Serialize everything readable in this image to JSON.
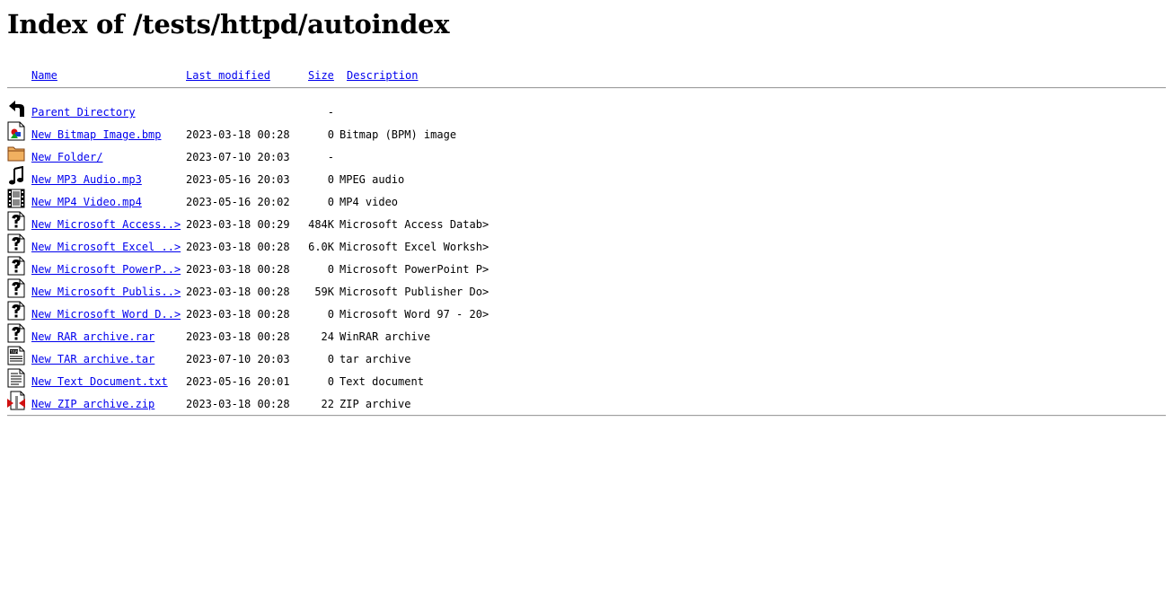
{
  "page": {
    "title": "Index of /tests/httpd/autoindex"
  },
  "columns": {
    "name": "Name",
    "last_modified": "Last modified",
    "size": "Size",
    "description": "Description"
  },
  "entries": [
    {
      "icon": "back-icon",
      "name": "Parent Directory",
      "modified": "",
      "size": "-",
      "description": ""
    },
    {
      "icon": "image-icon",
      "name": "New Bitmap Image.bmp",
      "modified": "2023-03-18 00:28",
      "size": "0",
      "description": "Bitmap (BPM) image"
    },
    {
      "icon": "folder-icon",
      "name": "New Folder/",
      "modified": "2023-07-10 20:03",
      "size": "-",
      "description": ""
    },
    {
      "icon": "audio-icon",
      "name": "New MP3 Audio.mp3",
      "modified": "2023-05-16 20:03",
      "size": "0",
      "description": "MPEG audio"
    },
    {
      "icon": "video-icon",
      "name": "New MP4 Video.mp4",
      "modified": "2023-05-16 20:02",
      "size": "0",
      "description": "MP4 video"
    },
    {
      "icon": "unknown-file-icon",
      "name": "New Microsoft Access..>",
      "modified": "2023-03-18 00:29",
      "size": "484K",
      "description": "Microsoft Access Datab>"
    },
    {
      "icon": "unknown-file-icon",
      "name": "New Microsoft Excel ..>",
      "modified": "2023-03-18 00:28",
      "size": "6.0K",
      "description": "Microsoft Excel Worksh>"
    },
    {
      "icon": "unknown-file-icon",
      "name": "New Microsoft PowerP..>",
      "modified": "2023-03-18 00:28",
      "size": "0",
      "description": "Microsoft PowerPoint P>"
    },
    {
      "icon": "unknown-file-icon",
      "name": "New Microsoft Publis..>",
      "modified": "2023-03-18 00:28",
      "size": "59K",
      "description": "Microsoft Publisher Do>"
    },
    {
      "icon": "unknown-file-icon",
      "name": "New Microsoft Word D..>",
      "modified": "2023-03-18 00:28",
      "size": "0",
      "description": "Microsoft Word 97 - 20>"
    },
    {
      "icon": "unknown-file-icon",
      "name": "New RAR archive.rar",
      "modified": "2023-03-18 00:28",
      "size": "24",
      "description": "WinRAR archive"
    },
    {
      "icon": "tar-icon",
      "name": "New TAR archive.tar",
      "modified": "2023-07-10 20:03",
      "size": "0",
      "description": "tar archive"
    },
    {
      "icon": "text-file-icon",
      "name": "New Text Document.txt",
      "modified": "2023-05-16 20:01",
      "size": "0",
      "description": "Text document"
    },
    {
      "icon": "compressed-file-icon",
      "name": "New ZIP archive.zip",
      "modified": "2023-03-18 00:28",
      "size": "22",
      "description": "ZIP archive"
    }
  ]
}
